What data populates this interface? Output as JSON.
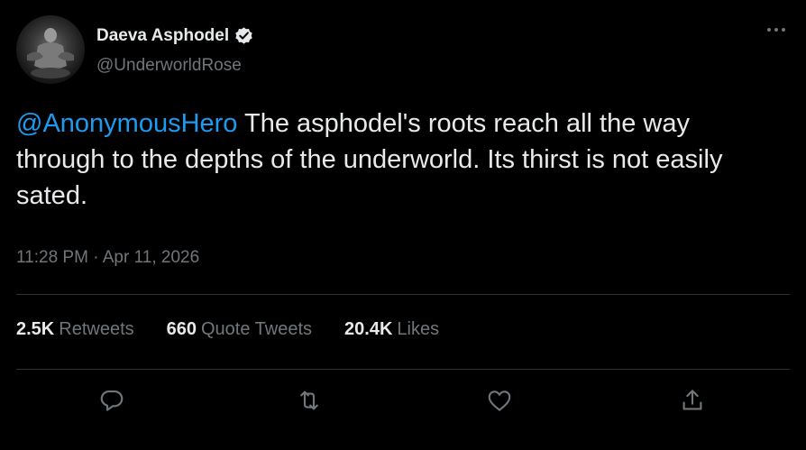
{
  "author": {
    "display_name": "Daeva Asphodel",
    "handle": "@UnderworldRose",
    "verified": true
  },
  "tweet": {
    "mention": "@AnonymousHero",
    "text": " The asphodel's roots reach all the way through to the depths of the underworld. Its thirst is not easily sated.",
    "timestamp": "11:28 PM · Apr 11, 2026"
  },
  "stats": [
    {
      "count": "2.5K",
      "label": "Retweets"
    },
    {
      "count": "660",
      "label": "Quote Tweets"
    },
    {
      "count": "20.4K",
      "label": "Likes"
    }
  ],
  "actions": [
    "reply-icon",
    "retweet-icon",
    "like-icon",
    "share-icon"
  ],
  "colors": {
    "background": "#000000",
    "text": "#e7e9ea",
    "secondary": "#71767b",
    "accent": "#1d9bf0",
    "divider": "#2f3336"
  }
}
